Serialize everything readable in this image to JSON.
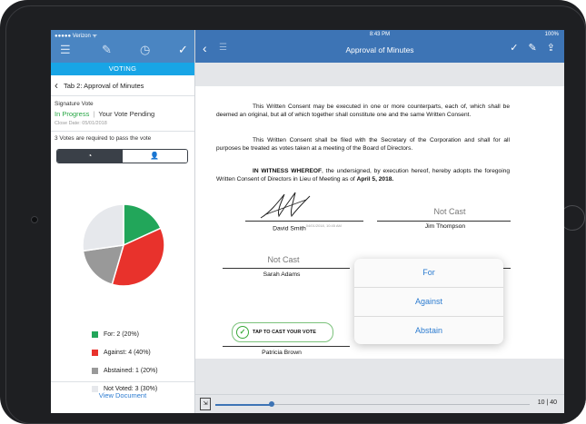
{
  "status": {
    "carrier": "●●●●● Verizon ᯤ",
    "time": "8:43 PM",
    "battery": "100%"
  },
  "left": {
    "tools": {
      "menu": "☰",
      "edit": "✎",
      "clock": "◷",
      "check": "✓"
    },
    "section_tab": "VOTING",
    "breadcrumb": "Tab 2: Approval of Minutes",
    "signature_vote_label": "Signature Vote",
    "status_in_progress": "In Progress",
    "status_vote": "Your Vote Pending",
    "close_date": "Close Date: 05/01/2018",
    "votes_required": "3 Votes are required to pass the vote",
    "segment_pie_icon": "◔",
    "segment_person_icon": "👤",
    "legend": [
      {
        "label": "For: 2 (20%)",
        "color": "#22a65a"
      },
      {
        "label": "Against: 4 (40%)",
        "color": "#e8322c"
      },
      {
        "label": "Abstained: 1 (20%)",
        "color": "#999999"
      },
      {
        "label": "Not Voted: 3 (30%)",
        "color": "#e6e8ec"
      }
    ],
    "view_document": "View Document"
  },
  "chart_data": {
    "type": "pie",
    "slices": [
      {
        "label": "For",
        "value": 20,
        "color": "#22a65a"
      },
      {
        "label": "Against",
        "value": 40,
        "color": "#e8322c"
      },
      {
        "label": "Abstained",
        "value": 20,
        "color": "#999999"
      },
      {
        "label": "Not Voted",
        "value": 30,
        "color": "#e6e8ec"
      }
    ]
  },
  "header": {
    "back": "‹",
    "list_icon": "☰",
    "title": "Approval of Minutes",
    "check": "✓",
    "pen": "✎",
    "share": "⇪"
  },
  "doc": {
    "para1": "This Written Consent may be executed in one or more counterparts, each of, which shall be deemed an original, but all of which together shall constitute one and the same Written Consent.",
    "para2": "This Written Consent shall be filed with the Secretary of the Corporation and shall for all purposes be treated as votes taken at a meeting of the Board of Directors.",
    "witness_bold": "IN WITNESS WHEREOF",
    "witness_rest": ", the undersigned, by execution hereof, hereby adopts the foregoing Written Consent of Directors in Lieu of Meeting as of",
    "witness_date": "April 5, 2018.",
    "signers": [
      {
        "name": "David Smith",
        "stamp": "04/01/2018, 10:45 AM"
      },
      {
        "name": "Jim Thompson",
        "status": "Not Cast"
      },
      {
        "name": "Sarah Adams",
        "status": "Not Cast"
      },
      {
        "name": "Patricia Brown"
      }
    ],
    "tap_to_vote": "TAP TO CAST YOUR VOTE"
  },
  "vote_options": [
    "For",
    "Against",
    "Abstain"
  ],
  "footer": {
    "page": "10 | 40",
    "progress": 0.18
  }
}
